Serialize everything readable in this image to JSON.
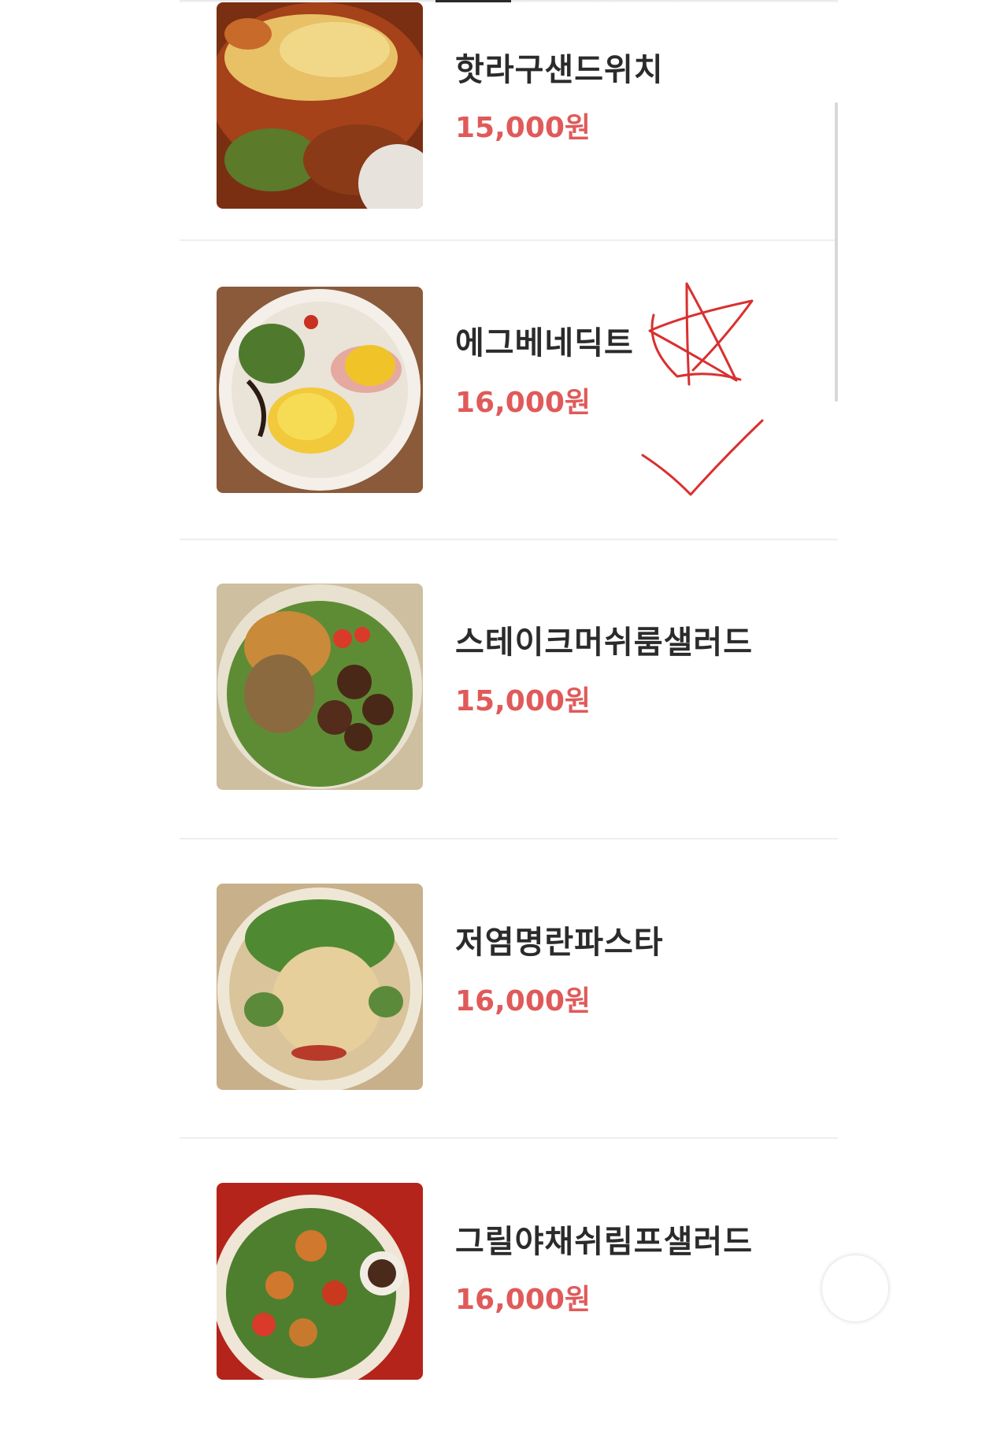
{
  "menu": {
    "items": [
      {
        "name": "핫라구샌드위치",
        "price": "15,000원",
        "image": "ragu-sandwich-photo"
      },
      {
        "name": "에그베네딕트",
        "price": "16,000원",
        "image": "eggs-benedict-photo"
      },
      {
        "name": "스테이크머쉬룸샐러드",
        "price": "15,000원",
        "image": "steak-mushroom-salad-photo"
      },
      {
        "name": "저염명란파스타",
        "price": "16,000원",
        "image": "mentaiko-pasta-photo"
      },
      {
        "name": "그릴야채쉬림프샐러드",
        "price": "16,000원",
        "image": "grilled-veg-shrimp-salad-photo"
      }
    ]
  },
  "annotations": {
    "marks": [
      "star-icon",
      "checkmark-icon"
    ],
    "color": "#d93030"
  },
  "colors": {
    "price": "#e05a5a",
    "name": "#2b2b2b",
    "divider": "#eeeeee"
  }
}
